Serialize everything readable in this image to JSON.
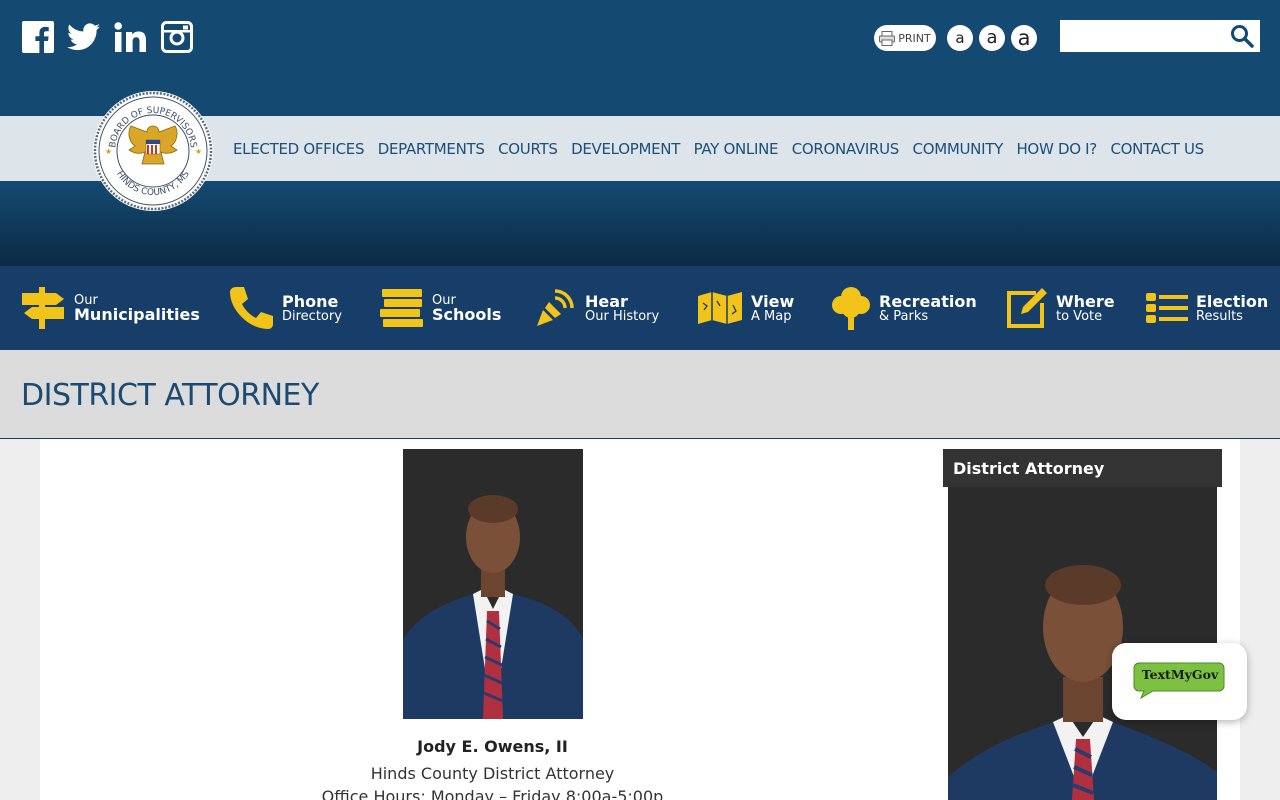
{
  "header": {
    "social": [
      {
        "name": "facebook-icon"
      },
      {
        "name": "twitter-icon"
      },
      {
        "name": "linkedin-icon"
      },
      {
        "name": "instagram-icon"
      }
    ],
    "print_label": "PRINT",
    "font_sizes": [
      "a",
      "a",
      "a"
    ],
    "search": {
      "placeholder": "",
      "value": ""
    }
  },
  "nav": {
    "items": [
      "ELECTED OFFICES",
      "DEPARTMENTS",
      "COURTS",
      "DEVELOPMENT",
      "PAY ONLINE",
      "CORONAVIRUS",
      "COMMUNITY",
      "HOW DO I?",
      "CONTACT US"
    ]
  },
  "seal": {
    "top_text": "BOARD OF SUPERVISORS",
    "bottom_text": "HINDS COUNTY, MS"
  },
  "quicklinks": [
    {
      "small": "Our",
      "big": "Municipalities",
      "icon": "signpost-icon",
      "big_first": false
    },
    {
      "small": "Directory",
      "big": "Phone",
      "icon": "phone-icon",
      "big_first": true
    },
    {
      "small": "Our",
      "big": "Schools",
      "icon": "books-icon",
      "big_first": false
    },
    {
      "small": "Our History",
      "big": "Hear",
      "icon": "sound-icon",
      "big_first": true
    },
    {
      "small": "A Map",
      "big": "View",
      "icon": "map-icon",
      "big_first": true
    },
    {
      "small": "& Parks",
      "big": "Recreation",
      "icon": "tree-icon",
      "big_first": true
    },
    {
      "small": "to Vote",
      "big": "Where",
      "icon": "edit-icon",
      "big_first": true
    },
    {
      "small": "Results",
      "big": "Election",
      "icon": "list-icon",
      "big_first": true
    }
  ],
  "page": {
    "title": "DISTRICT ATTORNEY",
    "name": "Jody E. Owens, II",
    "role": "Hinds County District Attorney",
    "hours": "Office Hours: Monday – Friday 8:00a-5:00p"
  },
  "sidebar": {
    "heading": "District Attorney"
  },
  "textmygov": {
    "label": "TextMyGov"
  },
  "colors": {
    "header_blue": "#144a72",
    "quickbar_blue": "#173e68",
    "accent_yellow": "#f2c318",
    "nav_text": "#1c4f7a"
  }
}
